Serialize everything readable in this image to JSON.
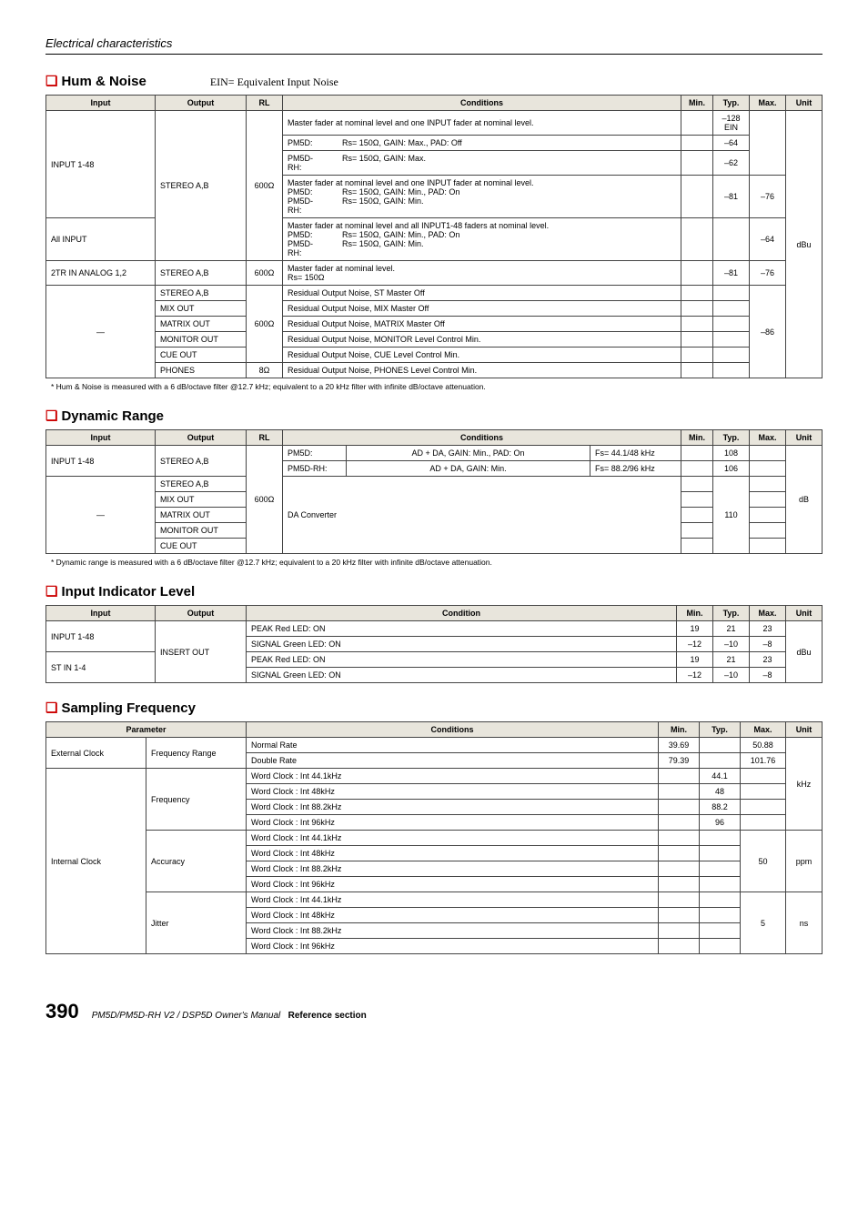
{
  "page": {
    "header": "Electrical characteristics",
    "number": "390",
    "footer_italic": "PM5D/PM5D-RH V2 / DSP5D Owner's Manual",
    "footer_bold": "Reference section"
  },
  "hum_noise": {
    "title": "Hum & Noise",
    "subtitle": "EIN= Equivalent Input Noise",
    "headers": {
      "input": "Input",
      "output": "Output",
      "rl": "RL",
      "conditions": "Conditions",
      "min": "Min.",
      "typ": "Typ.",
      "max": "Max.",
      "unit": "Unit"
    },
    "rows": {
      "r1": {
        "input": "INPUT 1-48",
        "output": "STEREO A,B",
        "rl": "600Ω",
        "cond": "Master fader at nominal level and one INPUT fader at nominal level.",
        "typ": "–128 EIN"
      },
      "r2": {
        "cond_l": "PM5D:",
        "cond_v": "Rs= 150Ω, GAIN: Max., PAD: Off",
        "typ": "–64"
      },
      "r3": {
        "cond_l": "PM5D-RH:",
        "cond_v": "Rs= 150Ω, GAIN: Max.",
        "typ": "–62"
      },
      "r4": {
        "cond": "Master fader at nominal level and one INPUT fader at nominal level.",
        "cond_l1": "PM5D:",
        "cond_v1": "Rs= 150Ω, GAIN: Min., PAD: On",
        "cond_l2": "PM5D-RH:",
        "cond_v2": "Rs= 150Ω, GAIN: Min.",
        "typ": "–81",
        "max": "–76"
      },
      "r5": {
        "input": "All INPUT",
        "cond": "Master fader at nominal level and all INPUT1-48 faders at nominal level.",
        "cond_l1": "PM5D:",
        "cond_v1": "Rs= 150Ω, GAIN: Min., PAD: On",
        "cond_l2": "PM5D-RH:",
        "cond_v2": "Rs= 150Ω, GAIN: Min.",
        "max": "–64",
        "unit": "dBu"
      },
      "r6": {
        "input": "2TR IN ANALOG 1,2",
        "output": "STEREO A,B",
        "rl": "600Ω",
        "cond": "Master fader at nominal level.",
        "cond2": "Rs= 150Ω",
        "typ": "–81",
        "max": "–76"
      },
      "r7": {
        "input": "—",
        "output": "STEREO A,B",
        "rl": "600Ω",
        "cond": "Residual Output Noise, ST Master Off",
        "max": "–86"
      },
      "r8": {
        "output": "MIX OUT",
        "cond": "Residual Output Noise, MIX Master Off"
      },
      "r9": {
        "output": "MATRIX OUT",
        "cond": "Residual Output Noise, MATRIX Master Off"
      },
      "r10": {
        "output": "MONITOR OUT",
        "cond": "Residual Output Noise, MONITOR Level Control Min."
      },
      "r11": {
        "output": "CUE OUT",
        "cond": "Residual Output Noise, CUE Level Control Min."
      },
      "r12": {
        "output": "PHONES",
        "rl": "8Ω",
        "cond": "Residual Output Noise, PHONES Level Control Min."
      }
    },
    "footnote": "*  Hum & Noise is measured with a 6 dB/octave filter @12.7 kHz; equivalent to a 20 kHz filter with infinite dB/octave attenuation."
  },
  "dynamic_range": {
    "title": "Dynamic Range",
    "headers": {
      "input": "Input",
      "output": "Output",
      "rl": "RL",
      "conditions": "Conditions",
      "min": "Min.",
      "typ": "Typ.",
      "max": "Max.",
      "unit": "Unit"
    },
    "rows": {
      "r1": {
        "input": "INPUT 1-48",
        "output": "STEREO A,B",
        "rl": "600Ω",
        "l": "PM5D:",
        "c": "AD + DA, GAIN: Min., PAD: On",
        "fs": "Fs= 44.1/48 kHz",
        "typ": "108",
        "unit": "dB"
      },
      "r2": {
        "l": "PM5D-RH:",
        "c": "AD + DA, GAIN: Min.",
        "fs": "Fs= 88.2/96 kHz",
        "typ": "106"
      },
      "r3": {
        "input": "—",
        "output": "STEREO A,B",
        "cond": "DA Converter",
        "typ": "110"
      },
      "r4": {
        "output": "MIX OUT"
      },
      "r5": {
        "output": "MATRIX OUT"
      },
      "r6": {
        "output": "MONITOR OUT"
      },
      "r7": {
        "output": "CUE OUT"
      }
    },
    "footnote": "*  Dynamic range is measured with a 6 dB/octave filter @12.7 kHz; equivalent to a 20 kHz filter with infinite dB/octave attenuation."
  },
  "input_indicator": {
    "title": "Input Indicator Level",
    "headers": {
      "input": "Input",
      "output": "Output",
      "condition": "Condition",
      "min": "Min.",
      "typ": "Typ.",
      "max": "Max.",
      "unit": "Unit"
    },
    "rows": {
      "r1": {
        "input": "INPUT 1-48",
        "output": "INSERT OUT",
        "cond": "PEAK Red LED: ON",
        "min": "19",
        "typ": "21",
        "max": "23",
        "unit": "dBu"
      },
      "r2": {
        "cond": "SIGNAL Green LED: ON",
        "min": "–12",
        "typ": "–10",
        "max": "–8"
      },
      "r3": {
        "input": "ST IN 1-4",
        "cond": "PEAK Red LED: ON",
        "min": "19",
        "typ": "21",
        "max": "23"
      },
      "r4": {
        "cond": "SIGNAL Green LED: ON",
        "min": "–12",
        "typ": "–10",
        "max": "–8"
      }
    }
  },
  "sampling": {
    "title": "Sampling Frequency",
    "headers": {
      "parameter": "Parameter",
      "conditions": "Conditions",
      "min": "Min.",
      "typ": "Typ.",
      "max": "Max.",
      "unit": "Unit"
    },
    "rows": {
      "r1": {
        "p1": "External Clock",
        "p2": "Frequency Range",
        "c": "Normal Rate",
        "min": "39.69",
        "max": "50.88",
        "unit": "kHz"
      },
      "r2": {
        "c": "Double Rate",
        "min": "79.39",
        "max": "101.76"
      },
      "r3": {
        "p1": "Internal Clock",
        "p2": "Frequency",
        "c": "Word Clock : Int 44.1kHz",
        "typ": "44.1"
      },
      "r4": {
        "c": "Word Clock : Int 48kHz",
        "typ": "48"
      },
      "r5": {
        "c": "Word Clock : Int 88.2kHz",
        "typ": "88.2"
      },
      "r6": {
        "c": "Word Clock : Int 96kHz",
        "typ": "96"
      },
      "r7": {
        "p2": "Accuracy",
        "c": "Word Clock : Int 44.1kHz",
        "max": "50",
        "unit": "ppm"
      },
      "r8": {
        "c": "Word Clock : Int 48kHz"
      },
      "r9": {
        "c": "Word Clock : Int 88.2kHz"
      },
      "r10": {
        "c": "Word Clock : Int 96kHz"
      },
      "r11": {
        "p2": "Jitter",
        "c": "Word Clock : Int 44.1kHz",
        "max": "5",
        "unit": "ns"
      },
      "r12": {
        "c": "Word Clock : Int 48kHz"
      },
      "r13": {
        "c": "Word Clock : Int 88.2kHz"
      },
      "r14": {
        "c": "Word Clock : Int 96kHz"
      }
    }
  }
}
